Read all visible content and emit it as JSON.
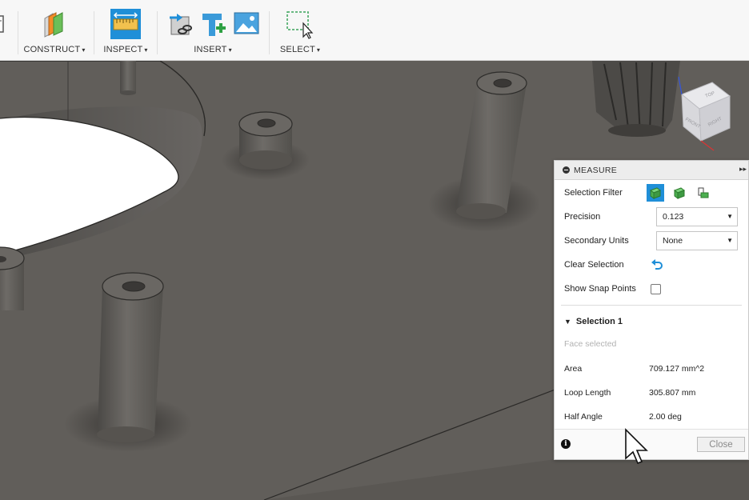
{
  "toolbar": {
    "groups": [
      {
        "id": "construct",
        "label": "CONSTRUCT",
        "icon": "construct-plane-icon"
      },
      {
        "id": "inspect",
        "label": "INSPECT",
        "icon": "measure-ruler-icon"
      },
      {
        "id": "insert",
        "label": "INSERT",
        "icons": [
          "insert-derive-icon",
          "insert-mcmaster-icon",
          "insert-canvas-icon"
        ]
      },
      {
        "id": "select",
        "label": "SELECT",
        "icon": "window-select-icon"
      }
    ],
    "caret": "▾"
  },
  "view_cube": {
    "top": "TOP",
    "front": "FRONT",
    "right": "RIGHT"
  },
  "measure": {
    "title": "MEASURE",
    "expand_glyph": "▸▸",
    "selection_filter_label": "Selection Filter",
    "precision_label": "Precision",
    "precision_value": "0.123",
    "secondary_units_label": "Secondary Units",
    "secondary_units_value": "None",
    "clear_selection_label": "Clear Selection",
    "show_snap_points_label": "Show Snap Points",
    "show_snap_points_checked": false,
    "selection_title": "Selection 1",
    "selection_status": "Face selected",
    "results": [
      {
        "key": "Area",
        "value": "709.127 mm^2"
      },
      {
        "key": "Loop Length",
        "value": "305.807 mm"
      },
      {
        "key": "Half Angle",
        "value": "2.00 deg"
      }
    ],
    "close_label": "Close",
    "info_glyph": "i"
  },
  "colors": {
    "accent_blue": "#1f8fd8",
    "filter_green": "#4caf50",
    "model_gray": "#615e5a"
  }
}
